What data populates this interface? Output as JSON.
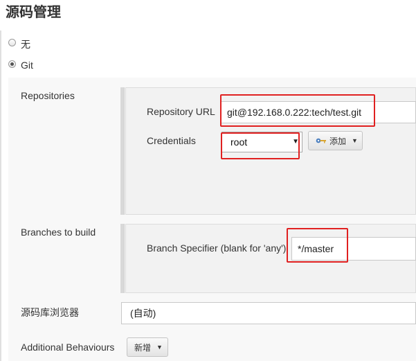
{
  "section_title": "源码管理",
  "scm_options": [
    {
      "label": "无",
      "selected": false
    },
    {
      "label": "Git",
      "selected": true
    }
  ],
  "repositories": {
    "label": "Repositories",
    "url_label": "Repository URL",
    "url_value": "git@192.168.0.222:tech/test.git",
    "credentials_label": "Credentials",
    "credentials_value": "root",
    "add_button_label": "添加"
  },
  "branches": {
    "label": "Branches to build",
    "specifier_label": "Branch Specifier (blank for 'any')",
    "specifier_value": "*/master"
  },
  "browser": {
    "label": "源码库浏览器",
    "value": "(自动)"
  },
  "additional": {
    "label": "Additional Behaviours",
    "add_button_label": "新增"
  },
  "colors": {
    "highlight": "#e02020",
    "key_icon": "#4a7fc0"
  },
  "icons": {
    "add_credentials": "key-icon"
  }
}
